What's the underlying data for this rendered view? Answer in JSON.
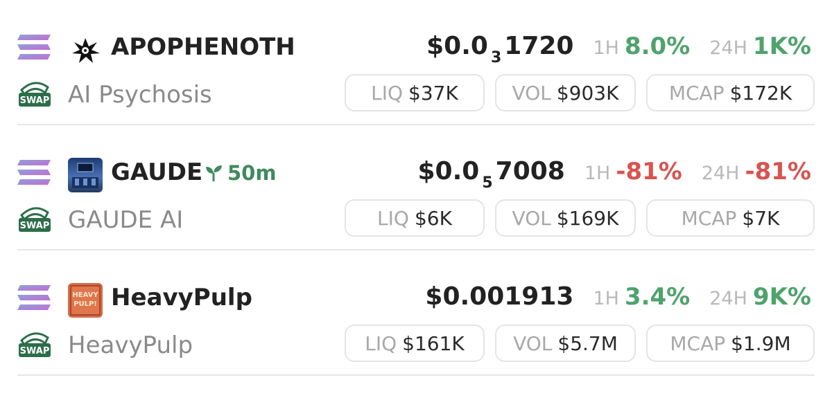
{
  "tokens": [
    {
      "symbol": "GAUDE",
      "age": "50m",
      "name": "GAUDE AI",
      "price_main": "$0.0",
      "price_sub": "5",
      "price_tail": "7008",
      "h1_label": "1H",
      "h1_change": "-81%",
      "h1_dir": "neg",
      "h24_label": "24H",
      "h24_change": "-81%",
      "h24_dir": "neg",
      "liq_label": "LIQ",
      "liq": "$6K",
      "vol_label": "VOL",
      "vol": "$169K",
      "mcap_label": "MCAP",
      "mcap": "$7K"
    },
    {
      "symbol": "HeavyPulp",
      "name": "HeavyPulp",
      "price_main": "$0.001913",
      "h1_label": "1H",
      "h1_change": "3.4%",
      "h1_dir": "pos",
      "h24_label": "24H",
      "h24_change": "9K%",
      "h24_dir": "pos",
      "liq_label": "LIQ",
      "liq": "$161K",
      "vol_label": "VOL",
      "vol": "$5.7M",
      "mcap_label": "MCAP",
      "mcap": "$1.9M",
      "avatar_text": "HEAVY PULP!"
    },
    {
      "symbol": "APOPHENOTH",
      "name": "AI Psychosis",
      "price_main": "$0.0",
      "price_sub": "3",
      "price_tail": "1720",
      "h1_label": "1H",
      "h1_change": "8.0%",
      "h1_dir": "pos",
      "h24_label": "24H",
      "h24_change": "1K%",
      "h24_dir": "pos",
      "liq_label": "LIQ",
      "liq": "$37K",
      "vol_label": "VOL",
      "vol": "$903K",
      "mcap_label": "MCAP",
      "mcap": "$172K"
    }
  ],
  "swap_badge": "SWAP",
  "colors": {
    "negative": "#d9534f",
    "positive": "#4ea36b",
    "age": "#3f8a5e"
  },
  "icons": {
    "chain": "solana-icon",
    "dex": "swap-icon",
    "age": "sprout-icon"
  }
}
